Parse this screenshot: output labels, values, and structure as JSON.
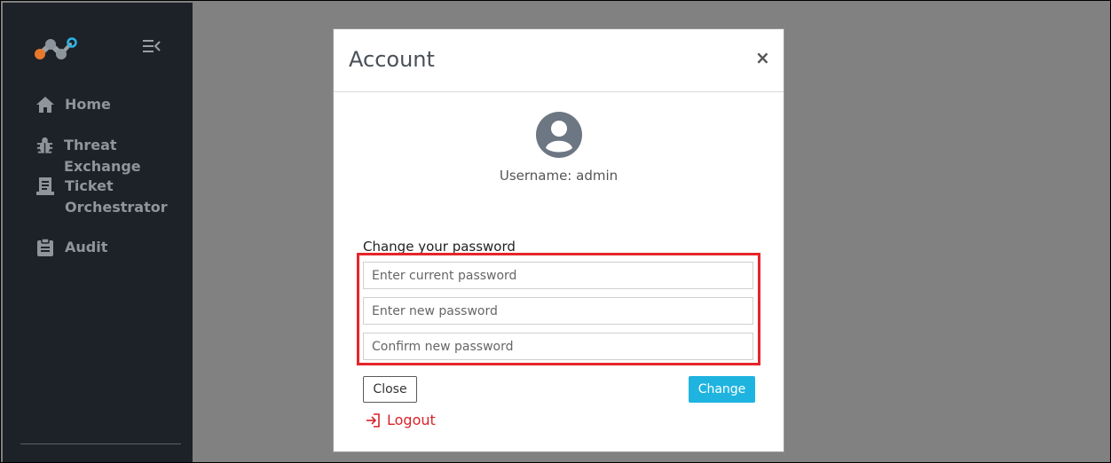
{
  "sidebar": {
    "logo_icon": "network-nodes-logo",
    "collapse_icon": "collapse-menu-icon",
    "items": [
      {
        "label": "Home",
        "icon": "home-icon"
      },
      {
        "label": "Threat Exchange",
        "icon": "bug-icon"
      },
      {
        "label": "Ticket\nOrchestrator",
        "icon": "ticket-icon"
      },
      {
        "label": "Audit",
        "icon": "clipboard-icon"
      }
    ]
  },
  "modal": {
    "title": "Account",
    "close_symbol": "×",
    "avatar_icon": "user-circle-icon",
    "username_text": "Username: admin",
    "change_password_label": "Change your password",
    "current_password_placeholder": "Enter current password",
    "new_password_placeholder": "Enter new password",
    "confirm_password_placeholder": "Confirm new password",
    "close_button_label": "Close",
    "change_button_label": "Change",
    "logout_label": "Logout",
    "logout_icon": "sign-out-icon"
  },
  "colors": {
    "sidebar_bg": "#1d2228",
    "overlay_bg": "#818181",
    "accent": "#1fb4e0",
    "logout": "#d9222a",
    "highlight": "#e5252a"
  }
}
